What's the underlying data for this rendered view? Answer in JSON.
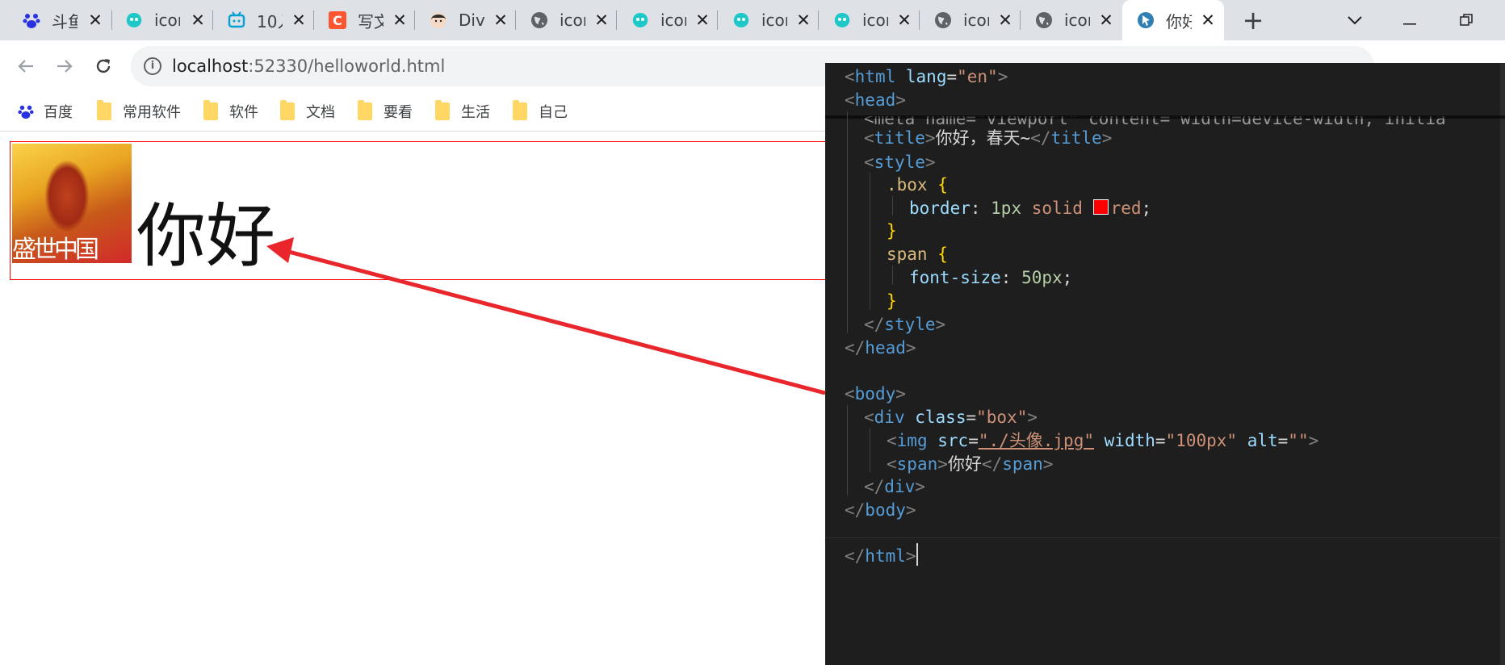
{
  "browser": {
    "tabs": [
      {
        "label": "斗鱼",
        "icon": "baidu-paw-icon"
      },
      {
        "label": "icon",
        "icon": "iconfont-icon"
      },
      {
        "label": "10入",
        "icon": "bilibili-icon"
      },
      {
        "label": "写文",
        "icon": "csdn-icon"
      },
      {
        "label": "Div",
        "icon": "avatar-icon"
      },
      {
        "label": "icon",
        "icon": "globe-icon"
      },
      {
        "label": "icon",
        "icon": "iconfont-icon"
      },
      {
        "label": "icon",
        "icon": "iconfont-icon"
      },
      {
        "label": "icon",
        "icon": "iconfont-icon"
      },
      {
        "label": "icon",
        "icon": "globe-icon"
      },
      {
        "label": "icon",
        "icon": "globe-icon"
      },
      {
        "label": "你好",
        "icon": "vscode-live-icon",
        "active": true
      }
    ],
    "close_glyph": "✕",
    "new_tab_glyph": "+",
    "url": {
      "host": "localhost",
      "rest": ":52330/helloworld.html"
    },
    "bookmarks": [
      {
        "label": "百度",
        "icon": "baidu-paw-icon"
      },
      {
        "label": "常用软件",
        "icon": "folder-icon"
      },
      {
        "label": "软件",
        "icon": "folder-icon"
      },
      {
        "label": "文档",
        "icon": "folder-icon"
      },
      {
        "label": "要看",
        "icon": "folder-icon"
      },
      {
        "label": "生活",
        "icon": "folder-icon"
      },
      {
        "label": "自己",
        "icon": "folder-icon"
      }
    ]
  },
  "page": {
    "span_text": "你好",
    "avatar_logo_text": "盛世中国",
    "box_border_color": "#ff0000"
  },
  "editor": {
    "lines": {
      "l1": {
        "open": "<",
        "tag": "html",
        "attr": "lang",
        "eq": "=",
        "val": "\"en\"",
        "close": ">"
      },
      "l2": {
        "open": "<",
        "tag": "head",
        "close": ">"
      },
      "l3": {
        "text": "<meta name=\"viewport\" content=\"width=device-width, initia"
      },
      "l4": {
        "open": "<",
        "tag": "title",
        "close": ">",
        "content": "你好，春天~",
        "end_open": "</",
        "end_tag": "title",
        "end_close": ">"
      },
      "l5": {
        "open": "<",
        "tag": "style",
        "close": ">"
      },
      "l6": {
        "selector": ".box",
        "brace": " {"
      },
      "l7": {
        "prop": "border",
        "colon": ": ",
        "num": "1px",
        "kw": " solid ",
        "color": "red",
        "semi": ";"
      },
      "l8": {
        "brace": "}"
      },
      "l9": {
        "selector": "span",
        "brace": " {"
      },
      "l10": {
        "prop": "font-size",
        "colon": ": ",
        "num": "50px",
        "semi": ";"
      },
      "l11": {
        "brace": "}"
      },
      "l12": {
        "open": "</",
        "tag": "style",
        "close": ">"
      },
      "l13": {
        "open": "</",
        "tag": "head",
        "close": ">"
      },
      "l14": {
        "open": "<",
        "tag": "body",
        "close": ">"
      },
      "l15": {
        "open": "<",
        "tag": "div",
        "attr": "class",
        "eq": "=",
        "val": "\"box\"",
        "close": ">"
      },
      "l16": {
        "open": "<",
        "tag": "img",
        "attr1": "src",
        "eq": "=",
        "val1": "\"./头像.jpg\"",
        "attr2": "width",
        "val2": "\"100px\"",
        "attr3": "alt",
        "val3": "\"\"",
        "close": ">"
      },
      "l17": {
        "open": "<",
        "tag": "span",
        "close": ">",
        "content": "你好",
        "end_open": "</",
        "end_tag": "span",
        "end_close": ">"
      },
      "l18": {
        "open": "</",
        "tag": "div",
        "close": ">"
      },
      "l19": {
        "open": "</",
        "tag": "body",
        "close": ">"
      },
      "l20": {
        "open": "</",
        "tag": "html",
        "close": ">"
      }
    }
  }
}
